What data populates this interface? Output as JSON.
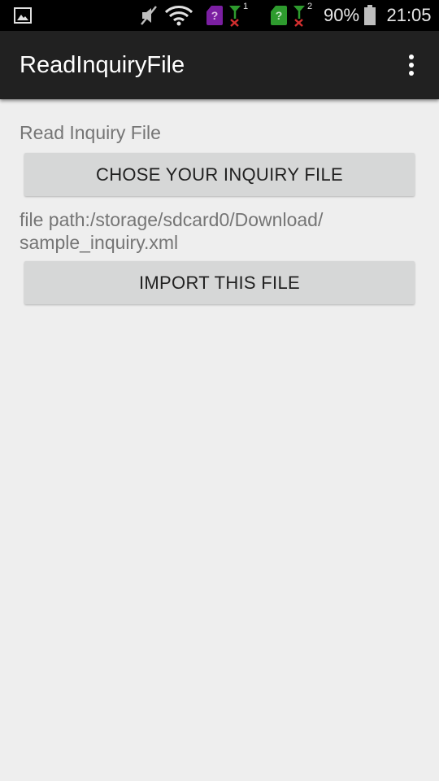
{
  "status_bar": {
    "battery_percent": "90%",
    "time": "21:05",
    "sim1_label": "?",
    "sim2_label": "?",
    "signal1_index": "1",
    "signal2_index": "2",
    "colors": {
      "sim1": "#7b1fa2",
      "sim2": "#2e9b2e",
      "no_signal_x": "#d32f2f"
    },
    "icons": [
      "image-notification-icon",
      "mute-icon",
      "wifi-icon",
      "sim-card-icon",
      "no-signal-icon",
      "battery-icon"
    ]
  },
  "app_bar": {
    "title": "ReadInquiryFile",
    "overflow_icon": "more-vert-icon"
  },
  "main": {
    "section_label": "Read Inquiry File",
    "choose_button_label": "CHOSE YOUR INQUIRY FILE",
    "file_path_text": "file path:/storage/sdcard0/Download/\nsample_inquiry.xml",
    "import_button_label": "IMPORT THIS FILE"
  }
}
